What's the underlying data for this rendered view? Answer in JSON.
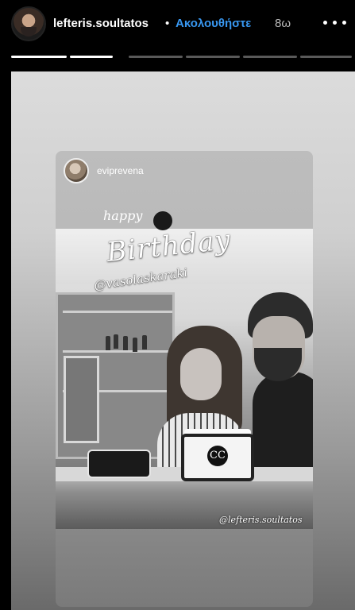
{
  "header": {
    "username": "lefteris.soultatos",
    "separator": "•",
    "follow_label": "Ακολουθήστε",
    "timestamp": "8ω",
    "more_icon": "more-horizontal-icon",
    "follow_color": "#3897f0"
  },
  "progress": {
    "segments": 6,
    "completed": 2
  },
  "story": {
    "shared_post": {
      "username": "eviprevena"
    },
    "sticker": {
      "line1": "happy",
      "line2": "Birthday",
      "mention": "@vasolaskaraki"
    },
    "photo_credit": "@lefteris.soultatos"
  }
}
